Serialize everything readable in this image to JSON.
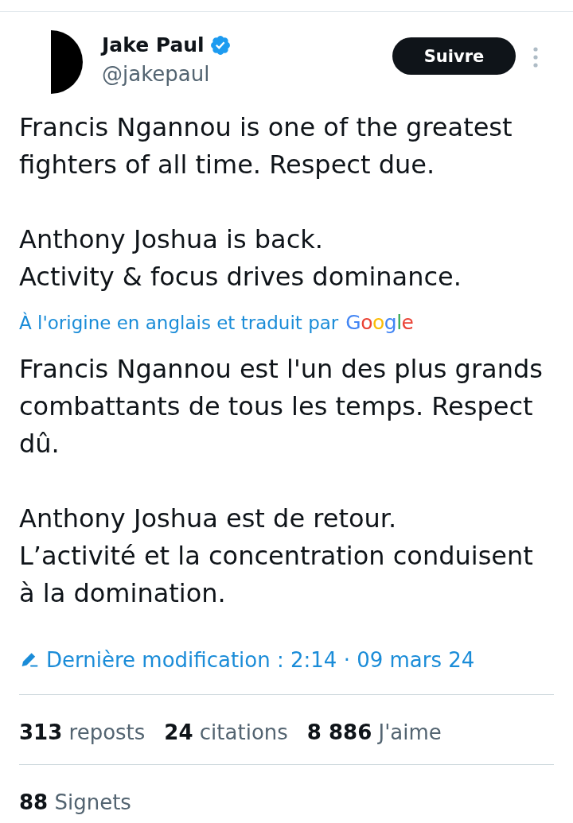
{
  "author": {
    "name": "Jake Paul",
    "handle": "@jakepaul",
    "verified": true
  },
  "follow_button": {
    "label": "Suivre"
  },
  "tweet_text": "Francis Ngannou is one of the greatest fighters of all time. Respect due.\n\nAnthony Joshua is back.\nActivity & focus drives dominance.",
  "translation_note": {
    "text": "À l'origine en anglais et traduit par",
    "provider": "Google"
  },
  "translated_text": "Francis Ngannou est l'un des plus grands combattants de tous les temps. Respect dû.\n\nAnthony Joshua est de retour.\nL’activité et la concentration conduisent à la domination.",
  "edit_info": {
    "text": "Dernière modification : 2:14 · 09 mars 24"
  },
  "stats": [
    {
      "count": "313",
      "label": "reposts"
    },
    {
      "count": "24",
      "label": "citations"
    },
    {
      "count": "8 886",
      "label": "J'aime"
    }
  ],
  "bookmarks": {
    "count": "88",
    "label": "Signets"
  }
}
